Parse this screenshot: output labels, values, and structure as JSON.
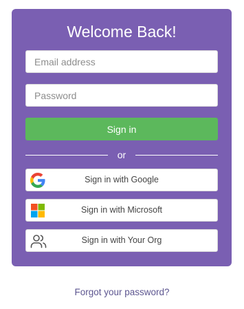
{
  "login": {
    "title": "Welcome Back!",
    "email_placeholder": "Email address",
    "password_placeholder": "Password",
    "signin_label": "Sign in",
    "divider_text": "or",
    "sso": {
      "google_label": "Sign in with Google",
      "microsoft_label": "Sign in with Microsoft",
      "org_label": "Sign in with Your Org"
    },
    "forgot_label": "Forgot your password?"
  },
  "icons": {
    "google": "google-icon",
    "microsoft": "microsoft-icon",
    "org": "users-icon"
  },
  "colors": {
    "card_background": "#7a5fb2",
    "signin_button": "#5cb85c",
    "link": "#5d5690"
  }
}
